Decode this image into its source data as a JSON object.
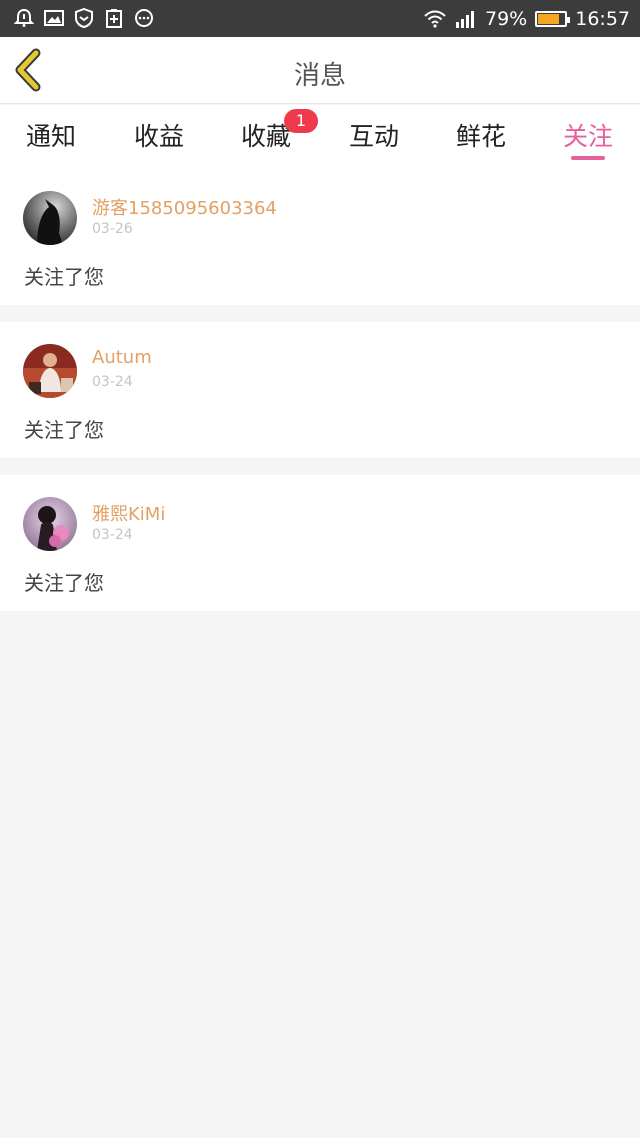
{
  "status_bar": {
    "battery_percent": "79%",
    "battery_level": 0.79,
    "time": "16:57",
    "left_icons": [
      "alarm-bell-icon",
      "image-icon",
      "shield-icon",
      "battery-saver-icon",
      "more-icon"
    ],
    "right_icons": [
      "wifi-icon",
      "signal-icon"
    ]
  },
  "header": {
    "title": "消息",
    "back_icon": "chevron-left-icon"
  },
  "tabs": [
    {
      "label": "通知",
      "active": false,
      "badge": null
    },
    {
      "label": "收益",
      "active": false,
      "badge": null
    },
    {
      "label": "收藏",
      "active": false,
      "badge": "1"
    },
    {
      "label": "互动",
      "active": false,
      "badge": null
    },
    {
      "label": "鲜花",
      "active": false,
      "badge": null
    },
    {
      "label": "关注",
      "active": true,
      "badge": null
    }
  ],
  "messages": [
    {
      "username": "游客1585095603364",
      "date": "03-26",
      "text": "关注了您"
    },
    {
      "username": "Autum",
      "date": "03-24",
      "text": "关注了您"
    },
    {
      "username": "雅熙KiMi",
      "date": "03-24",
      "text": "关注了您"
    }
  ],
  "colors": {
    "accent": "#e8609a",
    "username": "#e2a064",
    "badge": "#ee3a4b",
    "back_arrow": "#e6c832",
    "status_bar": "#3c3c3c"
  }
}
